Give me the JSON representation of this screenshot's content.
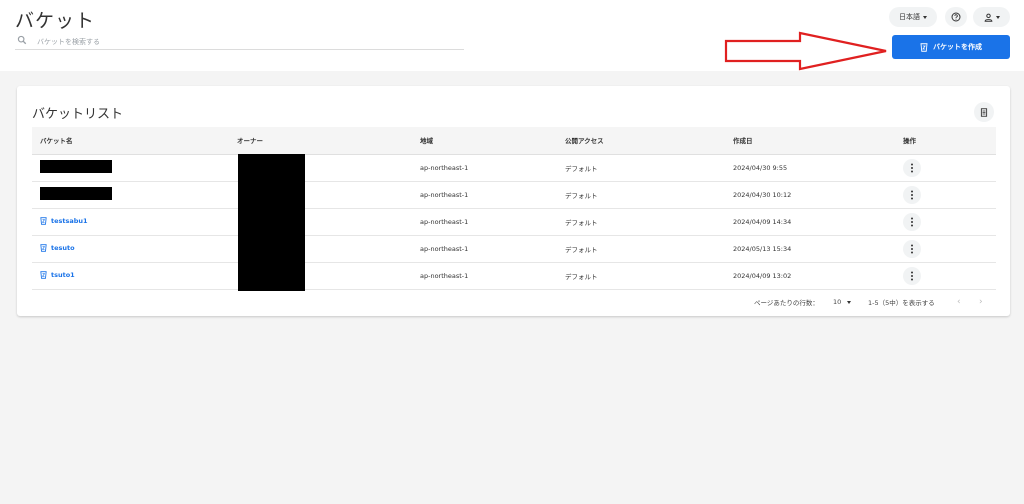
{
  "header": {
    "title": "バケット",
    "search_placeholder": "バケットを検索する",
    "language_label": "日本語",
    "create_button_label": "バケットを作成"
  },
  "card": {
    "title": "バケットリスト",
    "columns": [
      "バケット名",
      "オーナー",
      "地域",
      "公開アクセス",
      "作成日",
      "操作"
    ],
    "rows": [
      {
        "name": "",
        "region": "ap-northeast-1",
        "access": "デフォルト",
        "created": "2024/04/30 9:55"
      },
      {
        "name": "",
        "region": "ap-northeast-1",
        "access": "デフォルト",
        "created": "2024/04/30 10:12"
      },
      {
        "name": "testsabu1",
        "region": "ap-northeast-1",
        "access": "デフォルト",
        "created": "2024/04/09 14:34"
      },
      {
        "name": "tesuto",
        "region": "ap-northeast-1",
        "access": "デフォルト",
        "created": "2024/05/13 15:34"
      },
      {
        "name": "tsuto1",
        "region": "ap-northeast-1",
        "access": "デフォルト",
        "created": "2024/04/09 13:02"
      }
    ]
  },
  "pagination": {
    "rows_per_page_label": "ページあたりの行数：",
    "rows_per_page_value": "10",
    "range_label": "1-5（5中）を表示する",
    "prev_symbol": "‹",
    "next_symbol": "›"
  },
  "colors": {
    "primary": "#1a73e8",
    "arrow": "#e02020",
    "background": "#f4f4f4"
  },
  "icons": [
    "search-icon",
    "help-circle-icon",
    "user-icon",
    "bucket-icon",
    "column-settings-icon",
    "more-vert-icon"
  ]
}
